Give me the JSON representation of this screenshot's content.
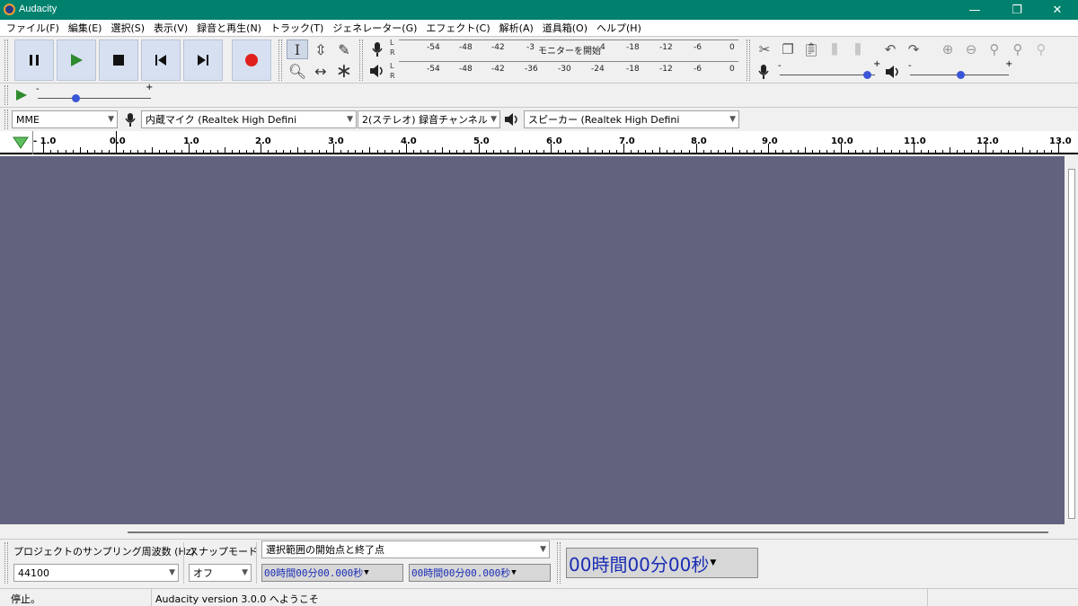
{
  "window": {
    "title": "Audacity",
    "minimize": "—",
    "restore": "❐",
    "close": "✕"
  },
  "menu": [
    "ファイル(F)",
    "編集(E)",
    "選択(S)",
    "表示(V)",
    "録音と再生(N)",
    "トラック(T)",
    "ジェネレーター(G)",
    "エフェクト(C)",
    "解析(A)",
    "道具箱(O)",
    "ヘルプ(H)"
  ],
  "meters": {
    "record_ticks": [
      "-54",
      "-48",
      "-42",
      "-3",
      "4",
      "-18",
      "-12",
      "-6",
      "0"
    ],
    "record_overlay": "モニターを開始",
    "playback_ticks": [
      "-54",
      "-48",
      "-42",
      "-36",
      "-30",
      "-24",
      "-18",
      "-12",
      "-6",
      "0"
    ],
    "left": "L",
    "right": "R"
  },
  "devices": {
    "host": "MME",
    "input": "内蔵マイク (Realtek High Defini",
    "channels": "2(ステレオ) 録音チャンネル",
    "output": "スピーカー (Realtek High Defini"
  },
  "ruler": [
    "- 1.0",
    "0.0",
    "1.0",
    "2.0",
    "3.0",
    "4.0",
    "5.0",
    "6.0",
    "7.0",
    "8.0",
    "9.0",
    "10.0",
    "11.0",
    "12.0",
    "13.0"
  ],
  "slider": {
    "minus": "-",
    "plus": "+"
  },
  "selection_bar": {
    "rate_label": "プロジェクトのサンプリング周波数 (Hz)",
    "rate_value": "44100",
    "snap_label": "スナップモード",
    "snap_value": "オフ",
    "selection_mode": "選択範囲の開始点と終了点",
    "start_time": "00時間00分00.000秒",
    "end_time": "00時間00分00.000秒"
  },
  "time_display": "00時間00分00秒",
  "status": {
    "state": "停止。",
    "message": "Audacity version 3.0.0 へようこそ"
  }
}
